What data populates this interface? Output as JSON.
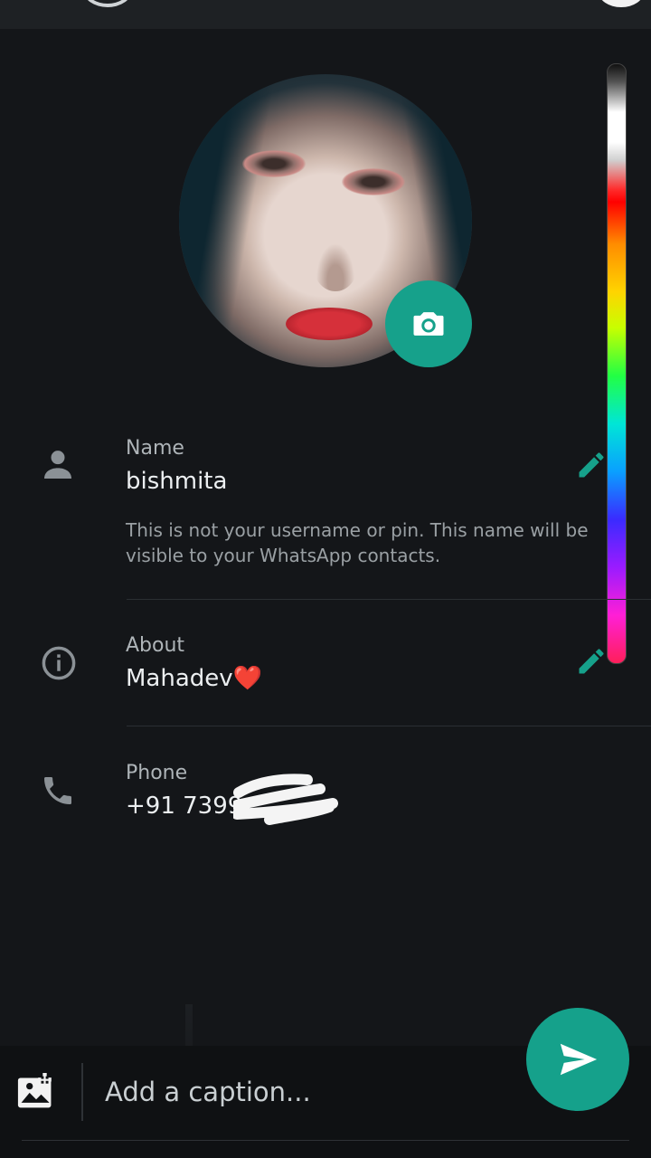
{
  "profile": {
    "name_label": "Name",
    "name_value": "bishmita",
    "name_hint": "This is not your username or pin. This name will be visible to your WhatsApp contacts.",
    "about_label": "About",
    "about_value": "Mahadev❤️",
    "phone_label": "Phone",
    "phone_value": "+91 7399"
  },
  "caption": {
    "placeholder": "Add a caption..."
  },
  "colors": {
    "accent": "#16a18b",
    "background": "#141619"
  },
  "icons": [
    "person-icon",
    "info-icon",
    "phone-icon",
    "camera-icon",
    "edit-icon",
    "add-image-icon",
    "send-icon"
  ]
}
